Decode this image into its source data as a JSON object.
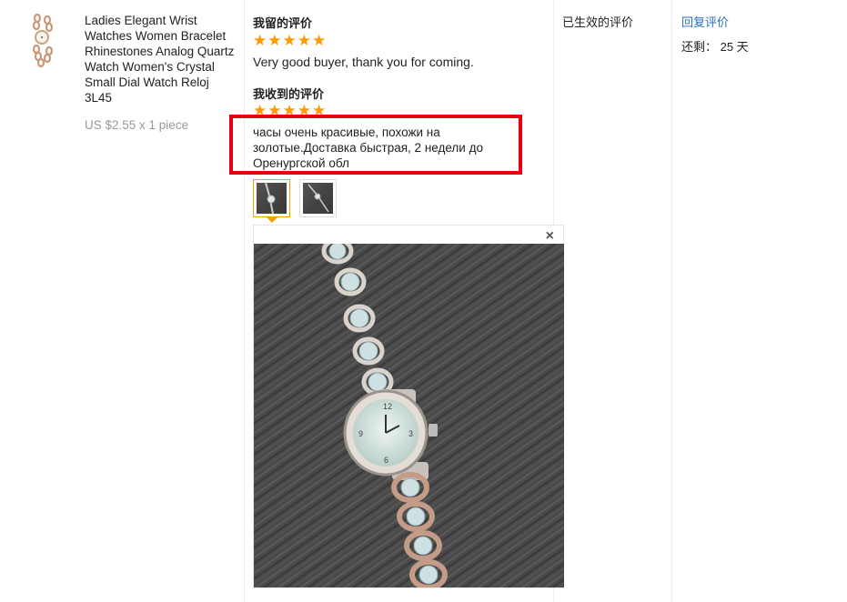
{
  "product": {
    "title": "Ladies Elegant Wrist Watches Women Bracelet Rhinestones Analog Quartz Watch Women's Crystal Small Dial Watch Reloj 3L45",
    "price": "US $2.55 x 1 piece",
    "thumbnail_icon": "watch-thumbnail"
  },
  "feedback": {
    "given_title": "我留的评价",
    "given_stars": 5,
    "given_text": "Very good buyer, thank you for coming.",
    "received_title": "我收到的评价",
    "received_stars": 5,
    "received_text": "часы очень красивые, похожи на золотые.Доставка быстрая, 2 недели до Оренургской обл",
    "highlight_color": "#e60012",
    "star_color": "#ff9900",
    "photos": [
      {
        "icon": "watch-photo-thumbnail",
        "active": true
      },
      {
        "icon": "watch-photo-thumbnail",
        "active": false
      }
    ],
    "viewer_close": "×"
  },
  "status": {
    "text": "已生效的评价"
  },
  "actions": {
    "reply_label": "回复评价",
    "remaining": "还剩： 25 天",
    "link_color": "#2a6ebb"
  }
}
